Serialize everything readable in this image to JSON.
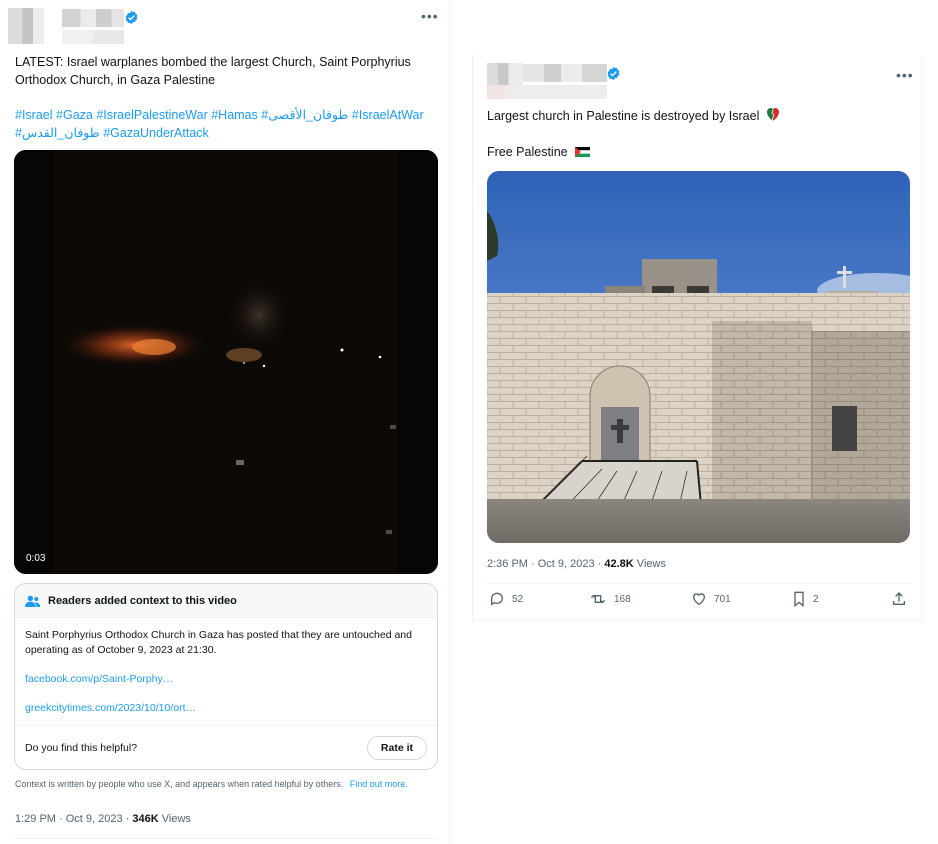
{
  "left_tweet": {
    "text": "LATEST: Israel warplanes bombed the largest Church, Saint Porphyrius Orthodox Church, in Gaza Palestine",
    "hashtags_line1": [
      "#Israel",
      "#Gaza",
      "#IsraelPalestineWar",
      "#Hamas",
      "#طوفان_الأقصى",
      "#IsraelAtWar"
    ],
    "hashtags_line2": [
      "#طوفان_القدس",
      "#GazaUnderAttack"
    ],
    "video_time": "0:03",
    "community_note": {
      "title": "Readers added context to this video",
      "body": "Saint Porphyrius Orthodox Church in Gaza has posted that they are untouched and operating as of  October 9, 2023 at 21:30.",
      "link1": "facebook.com/p/Saint-Porphy…",
      "link2": "greekcitytimes.com/2023/10/10/ort…",
      "question": "Do you find this helpful?",
      "rate_button": "Rate it"
    },
    "context_text": "Context is written by people who use X, and appears when rated helpful by others.",
    "find_out_more": "Find out more.",
    "timestamp": "1:29 PM · Oct 9, 2023 · ",
    "views_count": "346K",
    "views_label": " Views"
  },
  "right_tweet": {
    "text1": "Largest church in Palestine is destroyed by Israel",
    "text2": "Free Palestine",
    "timestamp": "2:36 PM · Oct 9, 2023 · ",
    "views_count": "42.8K",
    "views_label": " Views",
    "actions": {
      "replies": "52",
      "reposts": "168",
      "likes": "701",
      "bookmarks": "2"
    }
  },
  "colors": {
    "accent": "#1d9bf0",
    "secondary_text": "#536471",
    "border": "#cfd9de"
  }
}
